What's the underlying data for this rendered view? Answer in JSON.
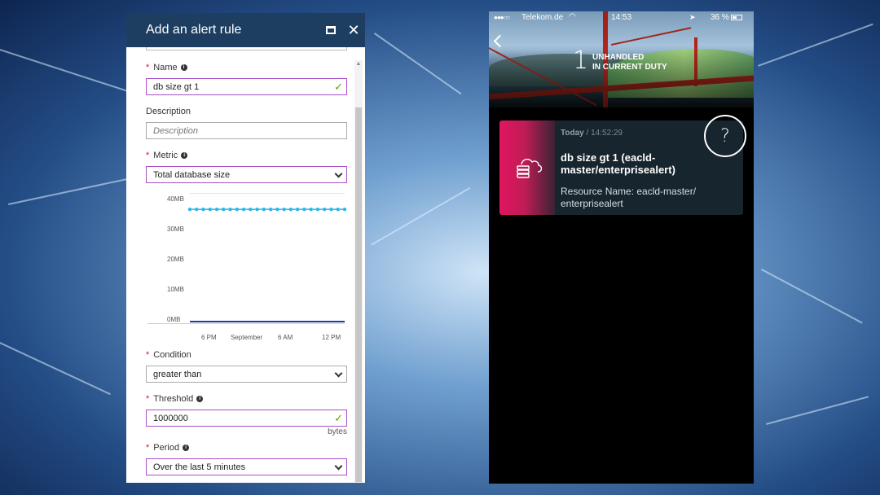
{
  "blade": {
    "title": "Add an alert rule",
    "name_label": "Name",
    "name_value": "db size gt 1",
    "description_label": "Description",
    "description_placeholder": "Description",
    "metric_label": "Metric",
    "metric_value": "Total database size",
    "condition_label": "Condition",
    "condition_value": "greater than",
    "threshold_label": "Threshold",
    "threshold_value": "1000000",
    "threshold_unit": "bytes",
    "period_label": "Period",
    "period_value": "Over the last 5 minutes",
    "required_mark": "*",
    "check_icon": "check-icon",
    "info_icon": "info-icon"
  },
  "chart_data": {
    "type": "line",
    "title": "",
    "xlabel": "",
    "ylabel": "",
    "y_ticks": [
      "40MB",
      "30MB",
      "20MB",
      "10MB",
      "0MB"
    ],
    "y_tick_values": [
      40,
      30,
      20,
      10,
      0
    ],
    "x_ticks": [
      "6 PM",
      "September",
      "6 AM",
      "12 PM"
    ],
    "ylim": [
      0,
      40
    ],
    "series": [
      {
        "color": "#2fb5e8",
        "markers": true,
        "values": [
          37,
          37,
          37,
          37,
          37,
          37,
          37,
          37,
          37,
          37,
          37,
          37,
          37,
          37,
          37,
          37,
          37,
          37,
          37,
          37,
          37,
          37,
          37,
          37
        ]
      },
      {
        "color": "#1a3aa8",
        "markers": false,
        "values": [
          0,
          0
        ]
      }
    ]
  },
  "phone": {
    "status": {
      "signal": "●●●○○",
      "carrier": "Telekom.de",
      "time": "14:53",
      "battery": "36 %"
    },
    "unhandled_count": "1",
    "unhandled_label_1": "UNHANDLED",
    "unhandled_label_2": "IN CURRENT DUTY",
    "card": {
      "day": "Today",
      "separator": " / ",
      "time": "14:52:29",
      "title": "db size gt 1 (eacld-master/enterprisealert)",
      "description": "Resource Name: eacld-master/ enterprisealert"
    },
    "help_label": "?"
  },
  "colors": {
    "azure_header": "#1e3e61",
    "valid_border": "#a84fc9",
    "accent_pink": "#e0155f"
  }
}
